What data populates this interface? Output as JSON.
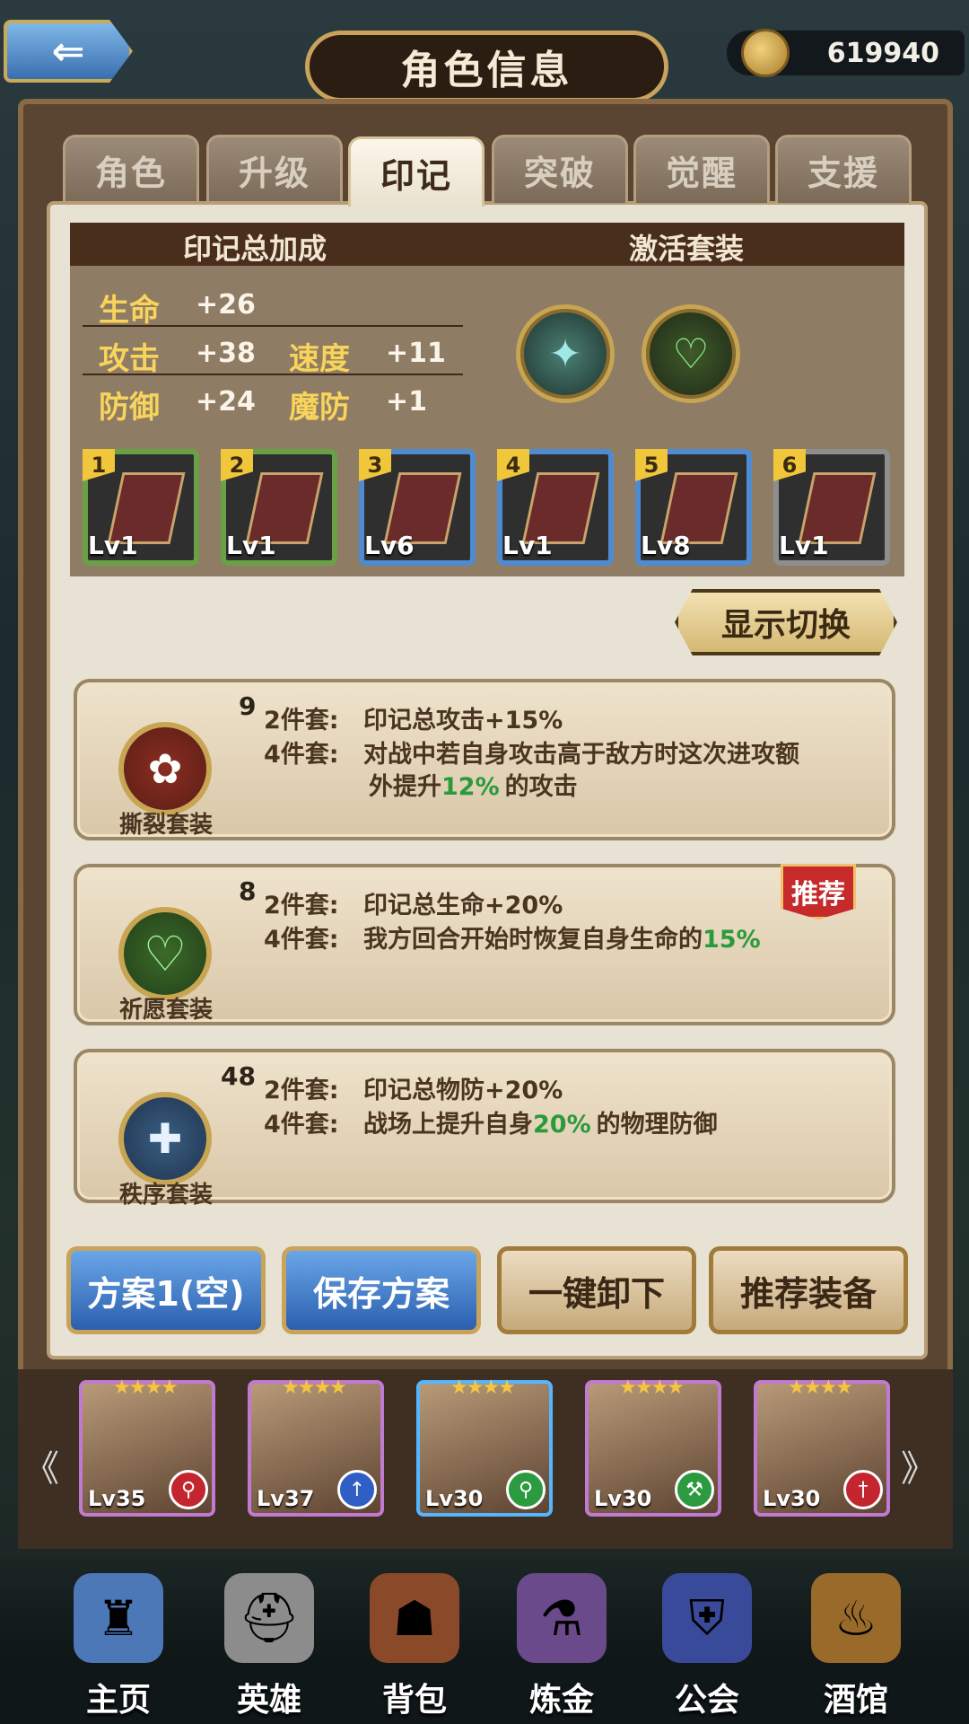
{
  "header": {
    "title": "角色信息",
    "coins": "619940"
  },
  "tabs": [
    "角色",
    "升级",
    "印记",
    "突破",
    "觉醒",
    "支援"
  ],
  "stats": {
    "head_left": "印记总加成",
    "head_right": "激活套装",
    "hp_label": "生命",
    "hp_value": "+26",
    "atk_label": "攻击",
    "atk_value": "+38",
    "spd_label": "速度",
    "spd_value": "+11",
    "def_label": "防御",
    "def_value": "+24",
    "mdef_label": "魔防",
    "mdef_value": "+1"
  },
  "slots": [
    {
      "num": "1",
      "level": "Lv1"
    },
    {
      "num": "2",
      "level": "Lv1"
    },
    {
      "num": "3",
      "level": "Lv6"
    },
    {
      "num": "4",
      "level": "Lv1"
    },
    {
      "num": "5",
      "level": "Lv8"
    },
    {
      "num": "6",
      "level": "Lv1"
    }
  ],
  "switch_label": "显示切换",
  "sets": [
    {
      "count": "9",
      "name": "撕裂套装",
      "two_label": "2件套:",
      "two": "印记总攻击+15%",
      "four_label": "4件套:",
      "four_a": "对战中若自身攻击高于敌方时这次进攻额",
      "four_b1": "外提升",
      "four_b_hl": "12%",
      "four_b2": "的攻击"
    },
    {
      "count": "8",
      "name": "祈愿套装",
      "two_label": "2件套:",
      "two": "印记总生命+20%",
      "four_label": "4件套:",
      "four_a1": "我方回合开始时恢复自身生命的",
      "four_a_hl": "15%"
    },
    {
      "count": "48",
      "name": "秩序套装",
      "two_label": "2件套:",
      "two": "印记总物防+20%",
      "four_label": "4件套:",
      "four_a1": "战场上提升自身",
      "four_a_hl": "20%",
      "four_a2": "的物理防御"
    }
  ],
  "recommend_badge": "推荐",
  "buttons": {
    "plan": "方案1(空)",
    "save": "保存方案",
    "unequip": "一键卸下",
    "recommend": "推荐装备"
  },
  "heroes": [
    {
      "level": "Lv35",
      "type_color": "#c3262e"
    },
    {
      "level": "Lv37",
      "type_color": "#2f5fc4"
    },
    {
      "level": "Lv30",
      "type_color": "#2c9a3e"
    },
    {
      "level": "Lv30",
      "type_color": "#2c9a3e"
    },
    {
      "level": "Lv30",
      "type_color": "#c3262e"
    }
  ],
  "nav": [
    "主页",
    "英雄",
    "背包",
    "炼金",
    "公会",
    "酒馆"
  ],
  "colors": {
    "highlight": "#2b9a3c",
    "accent_gold": "#c9a35b"
  }
}
